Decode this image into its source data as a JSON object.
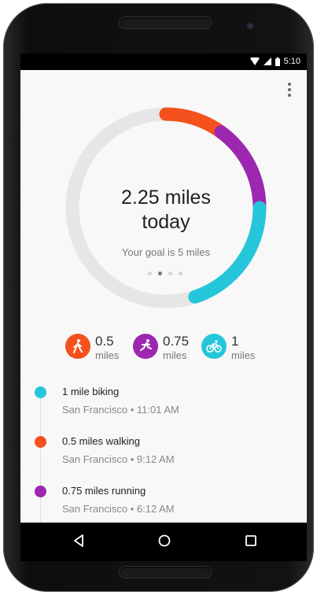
{
  "status_bar": {
    "time": "5:10"
  },
  "summary": {
    "distance_line1": "2.25 miles",
    "distance_line2": "today",
    "goal_text": "Your goal is 5 miles",
    "goal_progress": 0.45,
    "segments": [
      {
        "activity": "walking",
        "miles": 0.5,
        "color": "#f4511e"
      },
      {
        "activity": "running",
        "miles": 0.75,
        "color": "#9c27b0"
      },
      {
        "activity": "biking",
        "miles": 1,
        "color": "#26c6da"
      }
    ],
    "track_color": "#e6e6e6",
    "page_dots": 4,
    "active_dot": 1
  },
  "activities": [
    {
      "value": "0.5",
      "unit": "miles",
      "icon": "walking-icon",
      "color": "#f4511e"
    },
    {
      "value": "0.75",
      "unit": "miles",
      "icon": "running-icon",
      "color": "#9c27b0"
    },
    {
      "value": "1",
      "unit": "miles",
      "icon": "biking-icon",
      "color": "#26c6da"
    }
  ],
  "timeline": [
    {
      "title": "1 mile biking",
      "subtitle": "San Francisco • 11:01 AM",
      "color": "#26c6da"
    },
    {
      "title": "0.5 miles walking",
      "subtitle": "San Francisco • 9:12 AM",
      "color": "#f4511e"
    },
    {
      "title": "0.75 miles running",
      "subtitle": "San Francisco • 6:12 AM",
      "color": "#9c27b0"
    }
  ]
}
